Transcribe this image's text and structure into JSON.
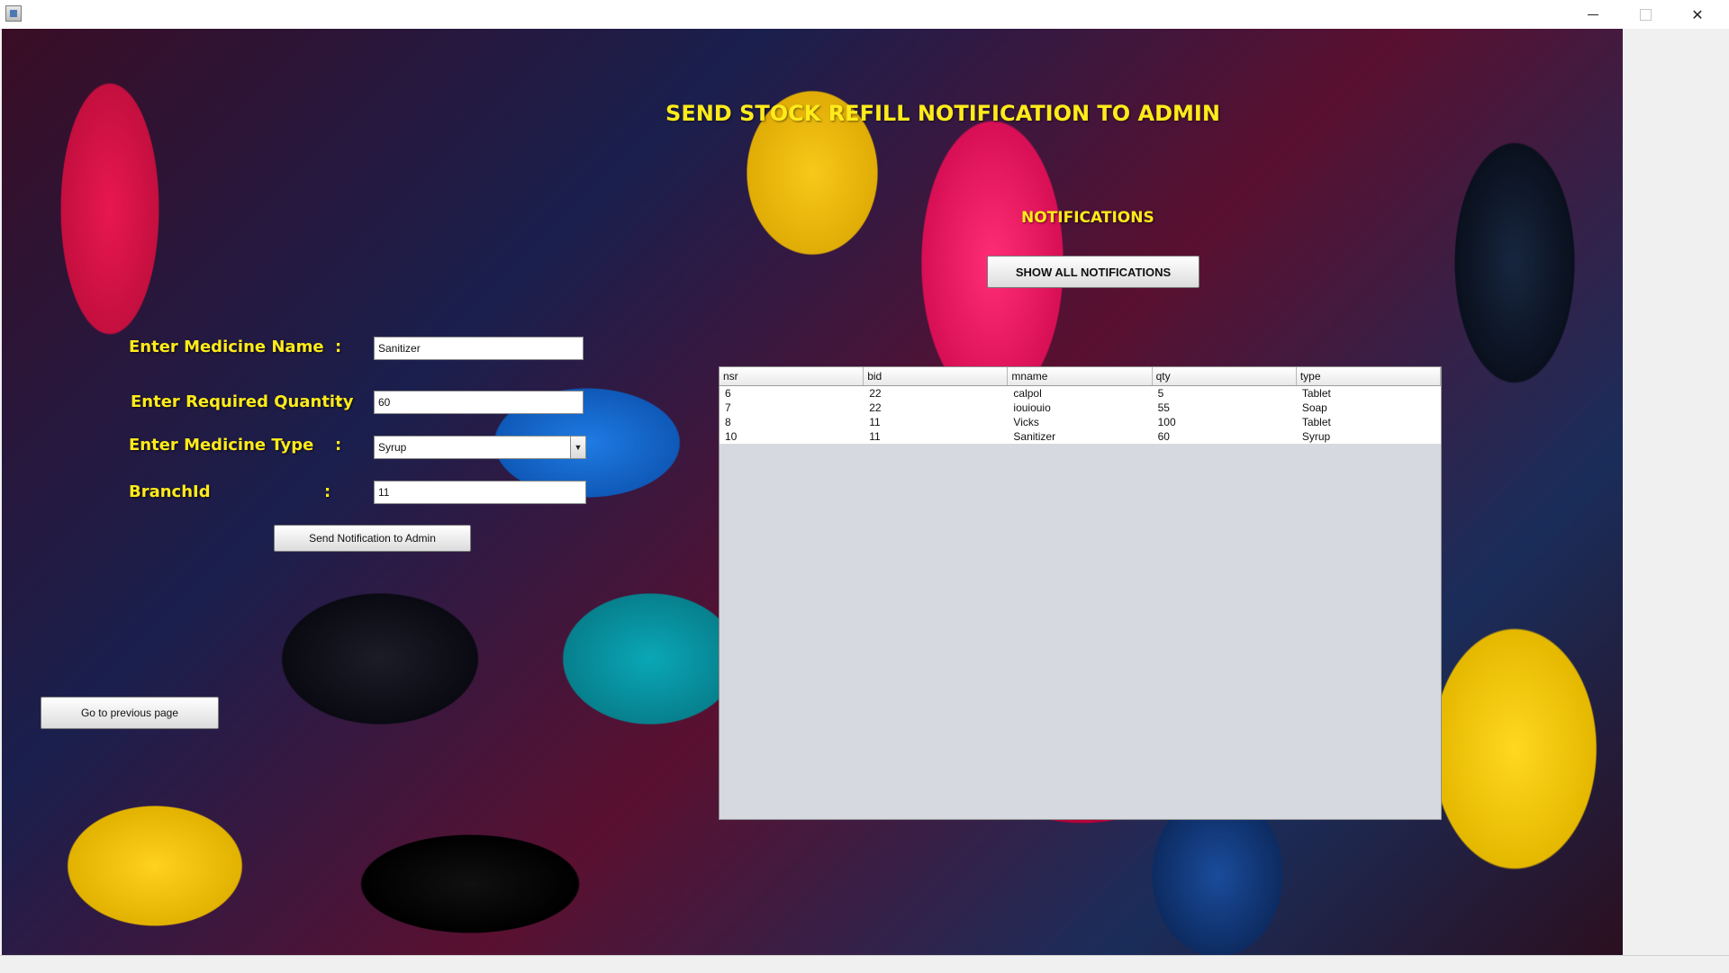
{
  "window": {
    "minimize_glyph": "",
    "close_glyph": "✕"
  },
  "page": {
    "title": "SEND STOCK REFILL NOTIFICATION TO ADMIN",
    "notifications_heading": "NOTIFICATIONS"
  },
  "form": {
    "medicine_name_label": "Enter Medicine Name",
    "medicine_name_value": "Sanitizer",
    "quantity_label": "Enter Required Quantity",
    "quantity_value": "60",
    "type_label": "Enter Medicine Type",
    "type_value": "Syrup",
    "branch_label": "BranchId",
    "branch_value": "11",
    "colon": ":",
    "send_button": "Send Notification to Admin"
  },
  "buttons": {
    "show_all": "SHOW ALL NOTIFICATIONS",
    "previous_page": "Go to previous page"
  },
  "table": {
    "columns": [
      "nsr",
      "bid",
      "mname",
      "qty",
      "type"
    ],
    "rows": [
      [
        "6",
        "22",
        "calpol",
        "5",
        "Tablet"
      ],
      [
        "7",
        "22",
        "iouiouio",
        "55",
        "Soap"
      ],
      [
        "8",
        "11",
        "Vicks",
        "100",
        "Tablet"
      ],
      [
        "10",
        "11",
        "Sanitizer",
        "60",
        "Syrup"
      ]
    ]
  },
  "colors": {
    "label_yellow": "#ffeb1a",
    "table_bg": "#d6d9e0"
  }
}
